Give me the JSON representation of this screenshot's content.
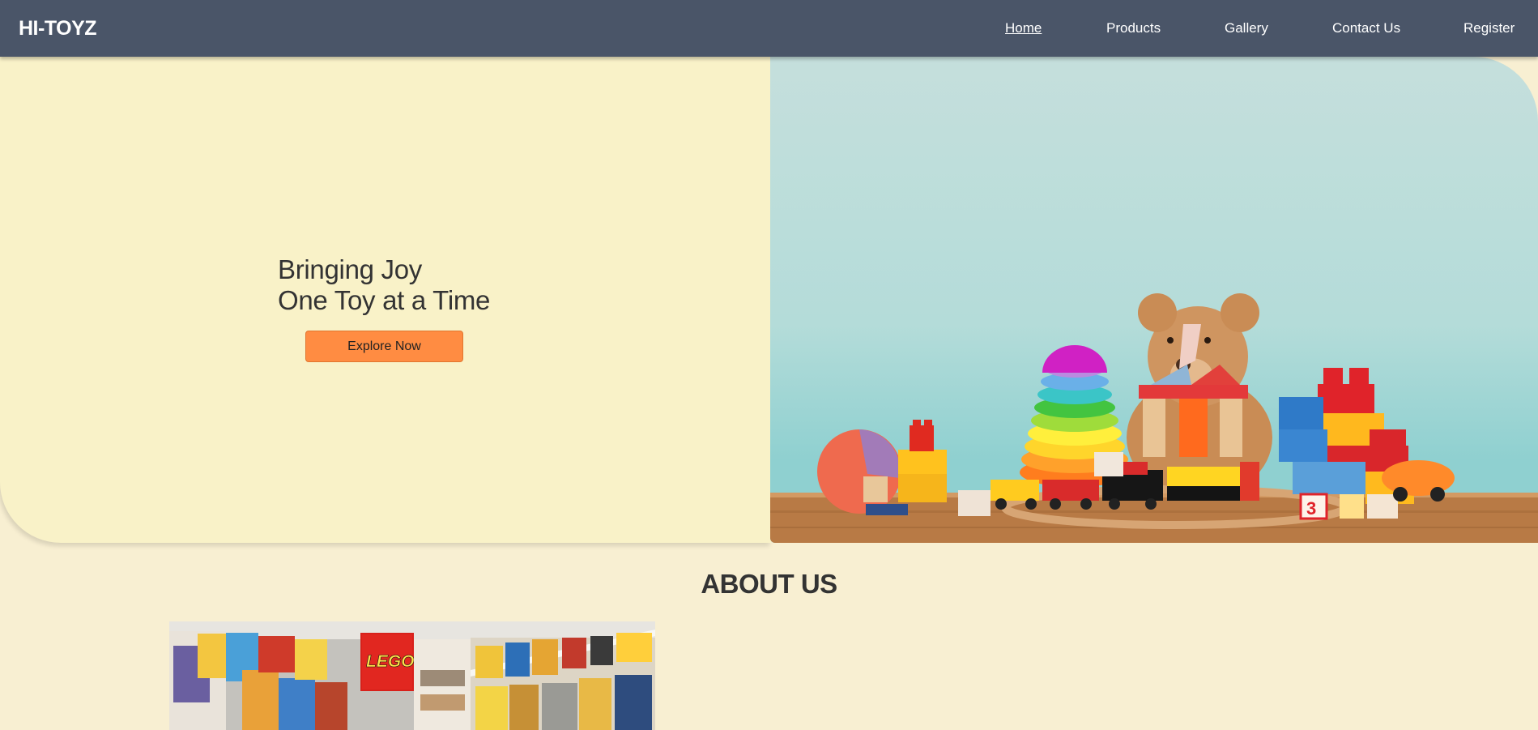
{
  "brand": {
    "name": "HI-TOYZ"
  },
  "nav": {
    "items": [
      {
        "label": "Home",
        "active": true
      },
      {
        "label": "Products",
        "active": false
      },
      {
        "label": "Gallery",
        "active": false
      },
      {
        "label": "Contact Us",
        "active": false
      },
      {
        "label": "Register",
        "active": false
      }
    ]
  },
  "hero": {
    "line1": "Bringing Joy",
    "line2": "One Toy at a Time",
    "cta_label": "Explore Now",
    "image_subject": "toys on wooden table: teddy bear, stacking rings, building blocks, toy train, ball"
  },
  "about": {
    "title": "ABOUT US",
    "image_subject": "toy store shelves with LEGO boxes",
    "store_sign": "LEGO"
  },
  "colors": {
    "header": "#4a5568",
    "hero_bg": "#f9f2c8",
    "page_bg": "#f8efd2",
    "cta": "#ff8c42"
  }
}
